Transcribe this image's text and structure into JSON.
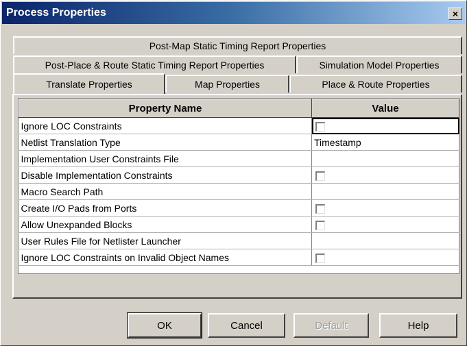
{
  "window": {
    "title": "Process Properties",
    "close_label": "×"
  },
  "tabs": {
    "row1": [
      "Post-Map Static Timing Report Properties"
    ],
    "row2": [
      "Post-Place & Route Static Timing Report Properties",
      "Simulation Model Properties"
    ],
    "row3": [
      "Translate Properties",
      "Map Properties",
      "Place & Route Properties"
    ],
    "active": "Translate Properties"
  },
  "table": {
    "headers": {
      "name": "Property Name",
      "value": "Value"
    },
    "rows": [
      {
        "name": "Ignore LOC Constraints",
        "type": "checkbox",
        "checked": false,
        "selected": true
      },
      {
        "name": "Netlist Translation Type",
        "type": "text",
        "value": "Timestamp"
      },
      {
        "name": "Implementation User Constraints File",
        "type": "text",
        "value": ""
      },
      {
        "name": "Disable Implementation Constraints",
        "type": "checkbox",
        "checked": false
      },
      {
        "name": "Macro Search Path",
        "type": "text",
        "value": ""
      },
      {
        "name": "Create I/O Pads from Ports",
        "type": "checkbox",
        "checked": false
      },
      {
        "name": "Allow Unexpanded Blocks",
        "type": "checkbox",
        "checked": false
      },
      {
        "name": "User Rules File for Netlister Launcher",
        "type": "text",
        "value": ""
      },
      {
        "name": "Ignore LOC Constraints on Invalid Object Names",
        "type": "checkbox",
        "checked": false
      }
    ]
  },
  "buttons": {
    "ok": "OK",
    "cancel": "Cancel",
    "default": "Default",
    "help": "Help"
  }
}
